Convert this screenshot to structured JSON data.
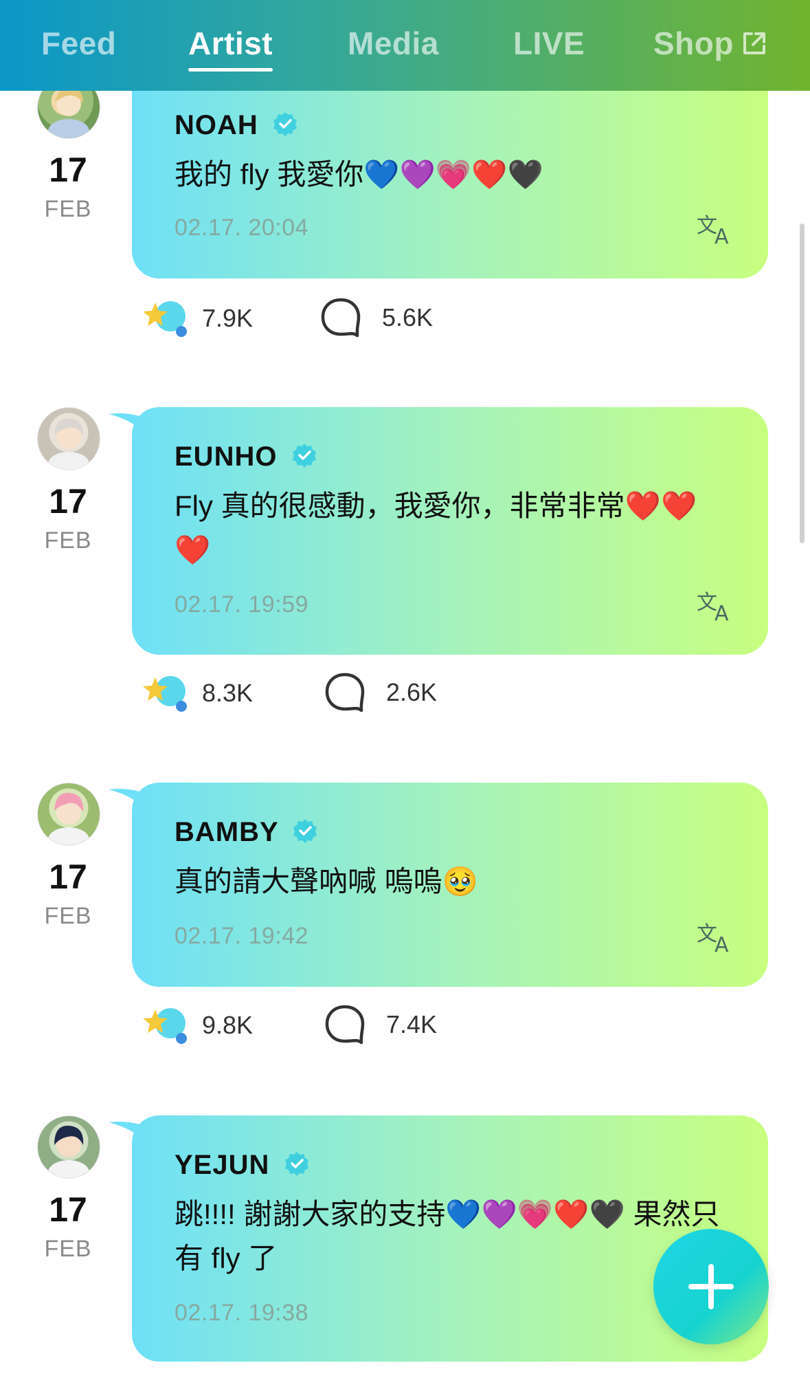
{
  "nav": {
    "tabs": [
      {
        "label": "Feed"
      },
      {
        "label": "Artist",
        "active": true
      },
      {
        "label": "Media"
      },
      {
        "label": "LIVE"
      },
      {
        "label": "Shop",
        "external": true
      }
    ]
  },
  "posts": [
    {
      "author": "NOAH",
      "day": "17",
      "month": "FEB",
      "text": "我的 fly 我愛你💙💜💗❤️🖤",
      "time": "02.17. 20:04",
      "likes": "7.9K",
      "comments": "5.6K"
    },
    {
      "author": "EUNHO",
      "day": "17",
      "month": "FEB",
      "text": "Fly 真的很感動，我愛你，非常非常❤️❤️❤️",
      "time": "02.17. 19:59",
      "likes": "8.3K",
      "comments": "2.6K"
    },
    {
      "author": "BAMBY",
      "day": "17",
      "month": "FEB",
      "text": "真的請大聲吶喊 嗚嗚🥹",
      "time": "02.17. 19:42",
      "likes": "9.8K",
      "comments": "7.4K"
    },
    {
      "author": "YEJUN",
      "day": "17",
      "month": "FEB",
      "text": "跳!!!! 謝謝大家的支持💙💜💗❤️🖤 果然只有 fly 了",
      "time": "02.17. 19:38"
    }
  ],
  "colors": {
    "accent": "#1fd6e6",
    "bubble_start": "#6ee0f7",
    "bubble_end": "#c8ff80",
    "verified": "#3fd0e0"
  },
  "icons": {
    "verified": "verified-badge-icon",
    "translate": "translate-icon",
    "like": "star-pick-icon",
    "comment": "comment-icon",
    "compose": "plus-icon",
    "external": "external-link-icon"
  }
}
